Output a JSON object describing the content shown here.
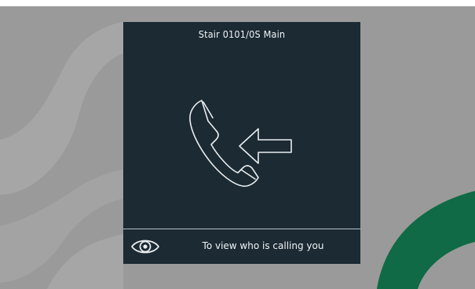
{
  "panel": {
    "title": "Stair 0101/0S Main",
    "footer_text": "To view who is calling you"
  },
  "icons": {
    "call": "incoming-call-icon",
    "view": "eye-icon"
  },
  "colors": {
    "background": "#9a9a9a",
    "panel": "#1b2a33",
    "accent_green": "#0f6a45",
    "text": "#f2f4f5"
  }
}
